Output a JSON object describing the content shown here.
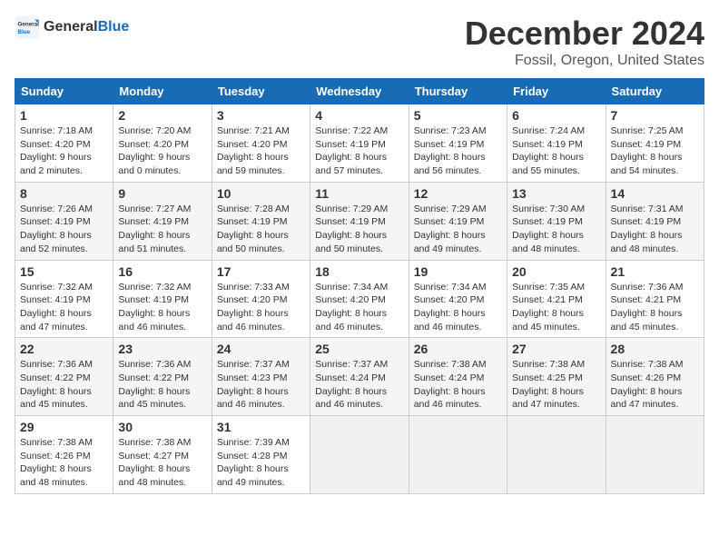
{
  "header": {
    "logo_general": "General",
    "logo_blue": "Blue",
    "title": "December 2024",
    "subtitle": "Fossil, Oregon, United States"
  },
  "calendar": {
    "weekdays": [
      "Sunday",
      "Monday",
      "Tuesday",
      "Wednesday",
      "Thursday",
      "Friday",
      "Saturday"
    ],
    "weeks": [
      [
        {
          "day": "1",
          "lines": [
            "Sunrise: 7:18 AM",
            "Sunset: 4:20 PM",
            "Daylight: 9 hours",
            "and 2 minutes."
          ]
        },
        {
          "day": "2",
          "lines": [
            "Sunrise: 7:20 AM",
            "Sunset: 4:20 PM",
            "Daylight: 9 hours",
            "and 0 minutes."
          ]
        },
        {
          "day": "3",
          "lines": [
            "Sunrise: 7:21 AM",
            "Sunset: 4:20 PM",
            "Daylight: 8 hours",
            "and 59 minutes."
          ]
        },
        {
          "day": "4",
          "lines": [
            "Sunrise: 7:22 AM",
            "Sunset: 4:19 PM",
            "Daylight: 8 hours",
            "and 57 minutes."
          ]
        },
        {
          "day": "5",
          "lines": [
            "Sunrise: 7:23 AM",
            "Sunset: 4:19 PM",
            "Daylight: 8 hours",
            "and 56 minutes."
          ]
        },
        {
          "day": "6",
          "lines": [
            "Sunrise: 7:24 AM",
            "Sunset: 4:19 PM",
            "Daylight: 8 hours",
            "and 55 minutes."
          ]
        },
        {
          "day": "7",
          "lines": [
            "Sunrise: 7:25 AM",
            "Sunset: 4:19 PM",
            "Daylight: 8 hours",
            "and 54 minutes."
          ]
        }
      ],
      [
        {
          "day": "8",
          "lines": [
            "Sunrise: 7:26 AM",
            "Sunset: 4:19 PM",
            "Daylight: 8 hours",
            "and 52 minutes."
          ]
        },
        {
          "day": "9",
          "lines": [
            "Sunrise: 7:27 AM",
            "Sunset: 4:19 PM",
            "Daylight: 8 hours",
            "and 51 minutes."
          ]
        },
        {
          "day": "10",
          "lines": [
            "Sunrise: 7:28 AM",
            "Sunset: 4:19 PM",
            "Daylight: 8 hours",
            "and 50 minutes."
          ]
        },
        {
          "day": "11",
          "lines": [
            "Sunrise: 7:29 AM",
            "Sunset: 4:19 PM",
            "Daylight: 8 hours",
            "and 50 minutes."
          ]
        },
        {
          "day": "12",
          "lines": [
            "Sunrise: 7:29 AM",
            "Sunset: 4:19 PM",
            "Daylight: 8 hours",
            "and 49 minutes."
          ]
        },
        {
          "day": "13",
          "lines": [
            "Sunrise: 7:30 AM",
            "Sunset: 4:19 PM",
            "Daylight: 8 hours",
            "and 48 minutes."
          ]
        },
        {
          "day": "14",
          "lines": [
            "Sunrise: 7:31 AM",
            "Sunset: 4:19 PM",
            "Daylight: 8 hours",
            "and 48 minutes."
          ]
        }
      ],
      [
        {
          "day": "15",
          "lines": [
            "Sunrise: 7:32 AM",
            "Sunset: 4:19 PM",
            "Daylight: 8 hours",
            "and 47 minutes."
          ]
        },
        {
          "day": "16",
          "lines": [
            "Sunrise: 7:32 AM",
            "Sunset: 4:19 PM",
            "Daylight: 8 hours",
            "and 46 minutes."
          ]
        },
        {
          "day": "17",
          "lines": [
            "Sunrise: 7:33 AM",
            "Sunset: 4:20 PM",
            "Daylight: 8 hours",
            "and 46 minutes."
          ]
        },
        {
          "day": "18",
          "lines": [
            "Sunrise: 7:34 AM",
            "Sunset: 4:20 PM",
            "Daylight: 8 hours",
            "and 46 minutes."
          ]
        },
        {
          "day": "19",
          "lines": [
            "Sunrise: 7:34 AM",
            "Sunset: 4:20 PM",
            "Daylight: 8 hours",
            "and 46 minutes."
          ]
        },
        {
          "day": "20",
          "lines": [
            "Sunrise: 7:35 AM",
            "Sunset: 4:21 PM",
            "Daylight: 8 hours",
            "and 45 minutes."
          ]
        },
        {
          "day": "21",
          "lines": [
            "Sunrise: 7:36 AM",
            "Sunset: 4:21 PM",
            "Daylight: 8 hours",
            "and 45 minutes."
          ]
        }
      ],
      [
        {
          "day": "22",
          "lines": [
            "Sunrise: 7:36 AM",
            "Sunset: 4:22 PM",
            "Daylight: 8 hours",
            "and 45 minutes."
          ]
        },
        {
          "day": "23",
          "lines": [
            "Sunrise: 7:36 AM",
            "Sunset: 4:22 PM",
            "Daylight: 8 hours",
            "and 45 minutes."
          ]
        },
        {
          "day": "24",
          "lines": [
            "Sunrise: 7:37 AM",
            "Sunset: 4:23 PM",
            "Daylight: 8 hours",
            "and 46 minutes."
          ]
        },
        {
          "day": "25",
          "lines": [
            "Sunrise: 7:37 AM",
            "Sunset: 4:24 PM",
            "Daylight: 8 hours",
            "and 46 minutes."
          ]
        },
        {
          "day": "26",
          "lines": [
            "Sunrise: 7:38 AM",
            "Sunset: 4:24 PM",
            "Daylight: 8 hours",
            "and 46 minutes."
          ]
        },
        {
          "day": "27",
          "lines": [
            "Sunrise: 7:38 AM",
            "Sunset: 4:25 PM",
            "Daylight: 8 hours",
            "and 47 minutes."
          ]
        },
        {
          "day": "28",
          "lines": [
            "Sunrise: 7:38 AM",
            "Sunset: 4:26 PM",
            "Daylight: 8 hours",
            "and 47 minutes."
          ]
        }
      ],
      [
        {
          "day": "29",
          "lines": [
            "Sunrise: 7:38 AM",
            "Sunset: 4:26 PM",
            "Daylight: 8 hours",
            "and 48 minutes."
          ]
        },
        {
          "day": "30",
          "lines": [
            "Sunrise: 7:38 AM",
            "Sunset: 4:27 PM",
            "Daylight: 8 hours",
            "and 48 minutes."
          ]
        },
        {
          "day": "31",
          "lines": [
            "Sunrise: 7:39 AM",
            "Sunset: 4:28 PM",
            "Daylight: 8 hours",
            "and 49 minutes."
          ]
        },
        {
          "day": "",
          "lines": []
        },
        {
          "day": "",
          "lines": []
        },
        {
          "day": "",
          "lines": []
        },
        {
          "day": "",
          "lines": []
        }
      ]
    ]
  }
}
